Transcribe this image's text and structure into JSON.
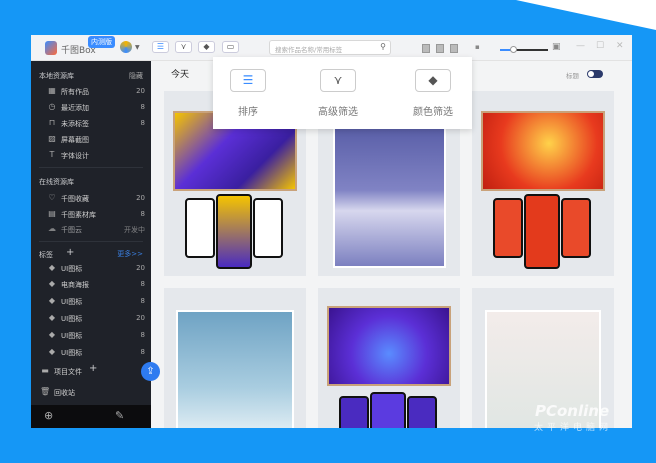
{
  "app": {
    "name": "千图Box",
    "badge": "内测版"
  },
  "search": {
    "placeholder": "搜索作品名称/常用标签"
  },
  "sidebar": {
    "local": {
      "title": "本地资源库",
      "action": "隐藏",
      "items": [
        {
          "label": "所有作品",
          "count": "20",
          "icon": "grid-icon"
        },
        {
          "label": "最近添加",
          "count": "8",
          "icon": "clock-icon"
        },
        {
          "label": "未添标签",
          "count": "8",
          "icon": "bookmark-icon"
        },
        {
          "label": "屏幕截图",
          "count": "",
          "icon": "image-icon"
        },
        {
          "label": "字体设计",
          "count": "",
          "icon": "text-icon"
        }
      ]
    },
    "online": {
      "title": "在线资源库",
      "items": [
        {
          "label": "千图收藏",
          "count": "20"
        },
        {
          "label": "千图素材库",
          "count": "8"
        },
        {
          "label": "千图云",
          "count": "开发中"
        }
      ]
    },
    "tags": {
      "title": "标签",
      "more": "更多>>",
      "items": [
        {
          "label": "UI图标",
          "count": "20"
        },
        {
          "label": "电商海报",
          "count": "8"
        },
        {
          "label": "UI图标",
          "count": "8"
        },
        {
          "label": "UI图标",
          "count": "20"
        },
        {
          "label": "UI图标",
          "count": "8"
        },
        {
          "label": "UI图标",
          "count": "8"
        }
      ]
    },
    "projects": "项目文件",
    "trash": "回收站"
  },
  "main": {
    "section": "今天",
    "title_toggle_label": "标题"
  },
  "popup": {
    "items": [
      {
        "label": "排序"
      },
      {
        "label": "高级筛选"
      },
      {
        "label": "颜色筛选"
      }
    ]
  },
  "watermark": {
    "brand": "PConline",
    "sub": "太平洋电脑网"
  }
}
